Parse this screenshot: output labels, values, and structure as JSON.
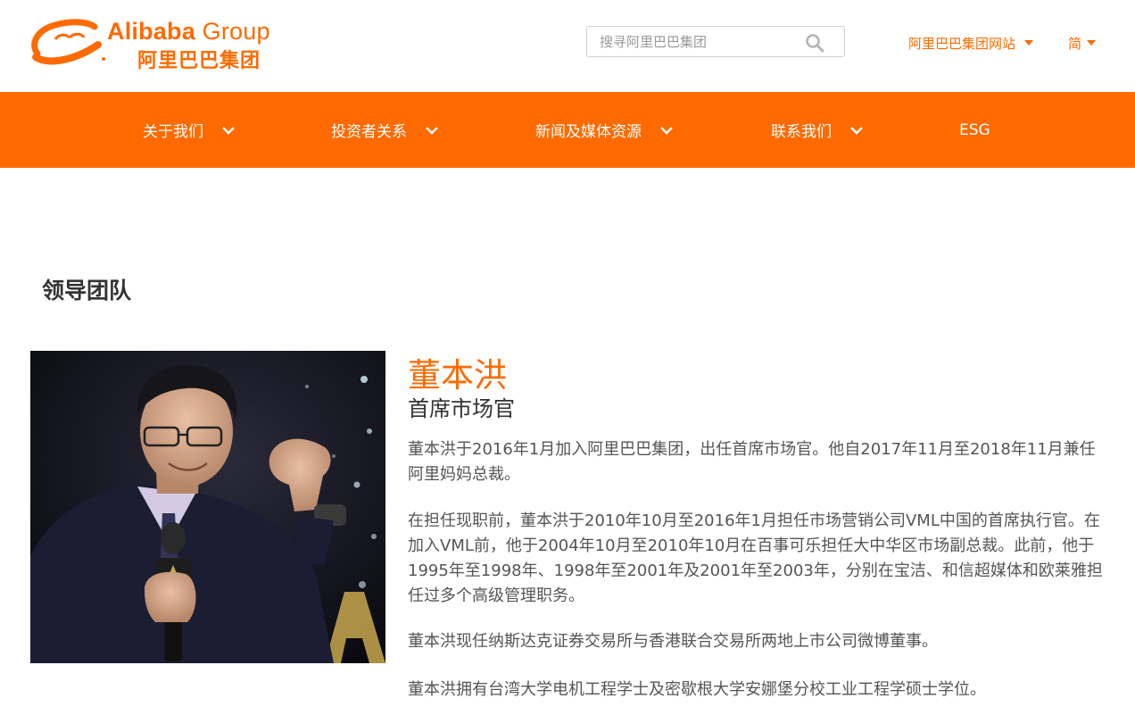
{
  "header": {
    "logo": {
      "brand_bold": "Alibaba",
      "brand_light": "Group",
      "brand_cn": "阿里巴巴集团",
      "icon": "alibaba-smile-logo",
      "brand_color": "#ff6a00"
    },
    "search": {
      "placeholder": "搜寻阿里巴巴集团",
      "value": "",
      "icon": "search-icon"
    },
    "site_selector": {
      "label": "阿里巴巴集团网站",
      "icon": "caret-down-icon"
    },
    "language_selector": {
      "label": "简",
      "icon": "caret-down-icon"
    }
  },
  "nav": {
    "background": "#ff6a00",
    "items": [
      {
        "label": "关于我们",
        "has_dropdown": true
      },
      {
        "label": "投资者关系",
        "has_dropdown": true
      },
      {
        "label": "新闻及媒体资源",
        "has_dropdown": true
      },
      {
        "label": "联系我们",
        "has_dropdown": true
      },
      {
        "label": "ESG",
        "has_dropdown": false
      }
    ]
  },
  "main": {
    "section_title": "领导团队",
    "profile": {
      "name": "董本洪",
      "title": "首席市场官",
      "photo": "portrait-photo",
      "bio": [
        "董本洪于2016年1月加入阿里巴巴集团，出任首席市场官。他自2017年11月至2018年11月兼任阿里妈妈总裁。",
        "在担任现职前，董本洪于2010年10月至2016年1月担任市场营销公司VML中国的首席执行官。在加入VML前，他于2004年10月至2010年10月在百事可乐担任大中华区市场副总裁。此前，他于1995年至1998年、1998年至2001年及2001年至2003年，分别在宝洁、和信超媒体和欧莱雅担任过多个高级管理职务。",
        "董本洪现任纳斯达克证券交易所与香港联合交易所两地上市公司微博董事。",
        "董本洪拥有台湾大学电机工程学士及密歇根大学安娜堡分校工业工程学硕士学位。"
      ]
    }
  }
}
